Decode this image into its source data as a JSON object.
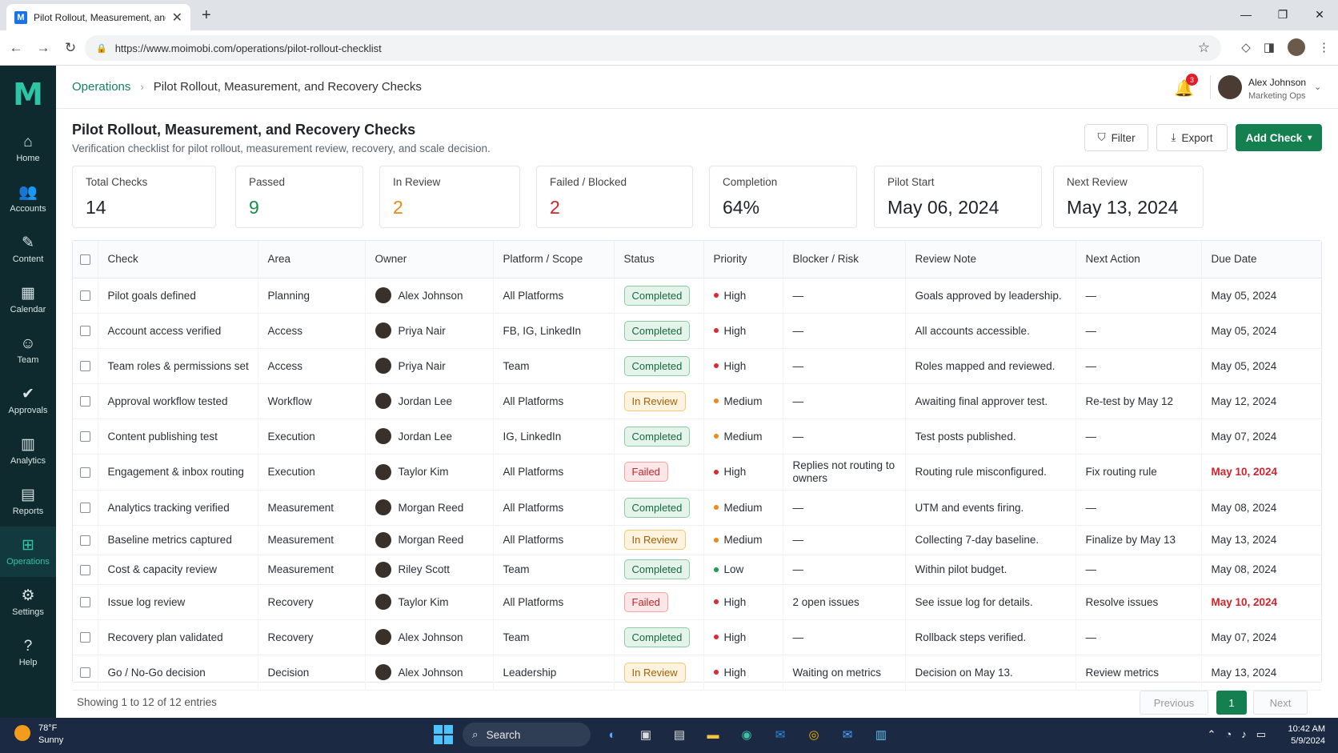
{
  "browser": {
    "tab_title": "Pilot Rollout, Measurement, and",
    "favicon": "M",
    "url": "https://www.moimobi.com/operations/pilot-rollout-checklist"
  },
  "sidebar": {
    "logo": "M",
    "items": [
      {
        "label": "Home",
        "icon": "home-icon",
        "glyph": "⌂"
      },
      {
        "label": "Accounts",
        "icon": "accounts-icon",
        "glyph": "👥"
      },
      {
        "label": "Content",
        "icon": "content-icon",
        "glyph": "✎"
      },
      {
        "label": "Calendar",
        "icon": "calendar-icon",
        "glyph": "▦"
      },
      {
        "label": "Team",
        "icon": "team-icon",
        "glyph": "☺"
      },
      {
        "label": "Approvals",
        "icon": "approvals-icon",
        "glyph": "✔"
      },
      {
        "label": "Analytics",
        "icon": "analytics-icon",
        "glyph": "▥"
      },
      {
        "label": "Reports",
        "icon": "reports-icon",
        "glyph": "▤"
      },
      {
        "label": "Operations",
        "icon": "operations-icon",
        "glyph": "⊞"
      },
      {
        "label": "Settings",
        "icon": "settings-icon",
        "glyph": "⚙"
      },
      {
        "label": "Help",
        "icon": "help-icon",
        "glyph": "?"
      }
    ],
    "active": "Operations"
  },
  "header": {
    "breadcrumb_root": "Operations",
    "breadcrumb_current": "Pilot Rollout, Measurement, and Recovery Checks",
    "notification_count": "3",
    "user_name": "Alex Johnson",
    "user_role": "Marketing Ops"
  },
  "page": {
    "title": "Pilot Rollout, Measurement, and Recovery Checks",
    "subtitle": "Verification checklist for pilot rollout, measurement review, recovery, and scale decision.",
    "filter_label": "Filter",
    "export_label": "Export",
    "add_label": "Add Check"
  },
  "stats": [
    {
      "label": "Total Checks",
      "value": "14",
      "color": "#1f2328"
    },
    {
      "label": "Passed",
      "value": "9",
      "color": "#1c8a4a"
    },
    {
      "label": "In Review",
      "value": "2",
      "color": "#e58a12"
    },
    {
      "label": "Failed / Blocked",
      "value": "2",
      "color": "#d1232b"
    },
    {
      "label": "Completion",
      "value": "64%",
      "color": "#1f2328"
    },
    {
      "label": "Pilot Start",
      "value": "May 06, 2024",
      "color": "#1f2328"
    },
    {
      "label": "Next Review",
      "value": "May 13, 2024",
      "color": "#1f2328"
    }
  ],
  "table": {
    "columns": [
      "Check",
      "Area",
      "Owner",
      "Platform / Scope",
      "Status",
      "Priority",
      "Blocker / Risk",
      "Review Note",
      "Next Action",
      "Due Date"
    ],
    "rows": [
      {
        "check": "Pilot goals defined",
        "area": "Planning",
        "owner": "Alex Johnson",
        "scope": "All Platforms",
        "status": "Completed",
        "priority": "High",
        "blocker": "—",
        "note": "Goals approved by leadership.",
        "next": "—",
        "due": "May 05, 2024",
        "overdue": false
      },
      {
        "check": "Account access verified",
        "area": "Access",
        "owner": "Priya Nair",
        "scope": "FB, IG, LinkedIn",
        "status": "Completed",
        "priority": "High",
        "blocker": "—",
        "note": "All accounts accessible.",
        "next": "—",
        "due": "May 05, 2024",
        "overdue": false
      },
      {
        "check": "Team roles & permissions set",
        "area": "Access",
        "owner": "Priya Nair",
        "scope": "Team",
        "status": "Completed",
        "priority": "High",
        "blocker": "—",
        "note": "Roles mapped and reviewed.",
        "next": "—",
        "due": "May 05, 2024",
        "overdue": false
      },
      {
        "check": "Approval workflow tested",
        "area": "Workflow",
        "owner": "Jordan Lee",
        "scope": "All Platforms",
        "status": "In Review",
        "priority": "Medium",
        "blocker": "—",
        "note": "Awaiting final approver test.",
        "next": "Re-test by May 12",
        "due": "May 12, 2024",
        "overdue": false
      },
      {
        "check": "Content publishing test",
        "area": "Execution",
        "owner": "Jordan Lee",
        "scope": "IG, LinkedIn",
        "status": "Completed",
        "priority": "Medium",
        "blocker": "—",
        "note": "Test posts published.",
        "next": "—",
        "due": "May 07, 2024",
        "overdue": false
      },
      {
        "check": "Engagement & inbox routing",
        "area": "Execution",
        "owner": "Taylor Kim",
        "scope": "All Platforms",
        "status": "Failed",
        "priority": "High",
        "blocker": "Replies not routing to owners",
        "note": "Routing rule misconfigured.",
        "next": "Fix routing rule",
        "due": "May 10, 2024",
        "overdue": true
      },
      {
        "check": "Analytics tracking verified",
        "area": "Measurement",
        "owner": "Morgan Reed",
        "scope": "All Platforms",
        "status": "Completed",
        "priority": "Medium",
        "blocker": "—",
        "note": "UTM and events firing.",
        "next": "—",
        "due": "May 08, 2024",
        "overdue": false
      },
      {
        "check": "Baseline metrics captured",
        "area": "Measurement",
        "owner": "Morgan Reed",
        "scope": "All Platforms",
        "status": "In Review",
        "priority": "Medium",
        "blocker": "—",
        "note": "Collecting 7-day baseline.",
        "next": "Finalize by May 13",
        "due": "May 13, 2024",
        "overdue": false
      },
      {
        "check": "Cost & capacity review",
        "area": "Measurement",
        "owner": "Riley Scott",
        "scope": "Team",
        "status": "Completed",
        "priority": "Low",
        "blocker": "—",
        "note": "Within pilot budget.",
        "next": "—",
        "due": "May 08, 2024",
        "overdue": false
      },
      {
        "check": "Issue log review",
        "area": "Recovery",
        "owner": "Taylor Kim",
        "scope": "All Platforms",
        "status": "Failed",
        "priority": "High",
        "blocker": "2 open issues",
        "note": "See issue log for details.",
        "next": "Resolve issues",
        "due": "May 10, 2024",
        "overdue": true
      },
      {
        "check": "Recovery plan validated",
        "area": "Recovery",
        "owner": "Alex Johnson",
        "scope": "Team",
        "status": "Completed",
        "priority": "High",
        "blocker": "—",
        "note": "Rollback steps verified.",
        "next": "—",
        "due": "May 07, 2024",
        "overdue": false
      },
      {
        "check": "Go / No-Go decision",
        "area": "Decision",
        "owner": "Alex Johnson",
        "scope": "Leadership",
        "status": "In Review",
        "priority": "High",
        "blocker": "Waiting on metrics",
        "note": "Decision on May 13.",
        "next": "Review metrics",
        "due": "May 13, 2024",
        "overdue": false
      }
    ]
  },
  "pagination": {
    "showing": "Showing 1 to 12 of  12 entries",
    "previous": "Previous",
    "current": "1",
    "next": "Next"
  },
  "colors": {
    "priority_high": "#e0262e",
    "priority_medium": "#ef8a14",
    "priority_low": "#1c9a50",
    "brand": "#14804f"
  },
  "taskbar": {
    "temp": "78°F",
    "weather": "Sunny",
    "search": "Search",
    "time": "10:42 AM",
    "date": "5/9/2024"
  }
}
